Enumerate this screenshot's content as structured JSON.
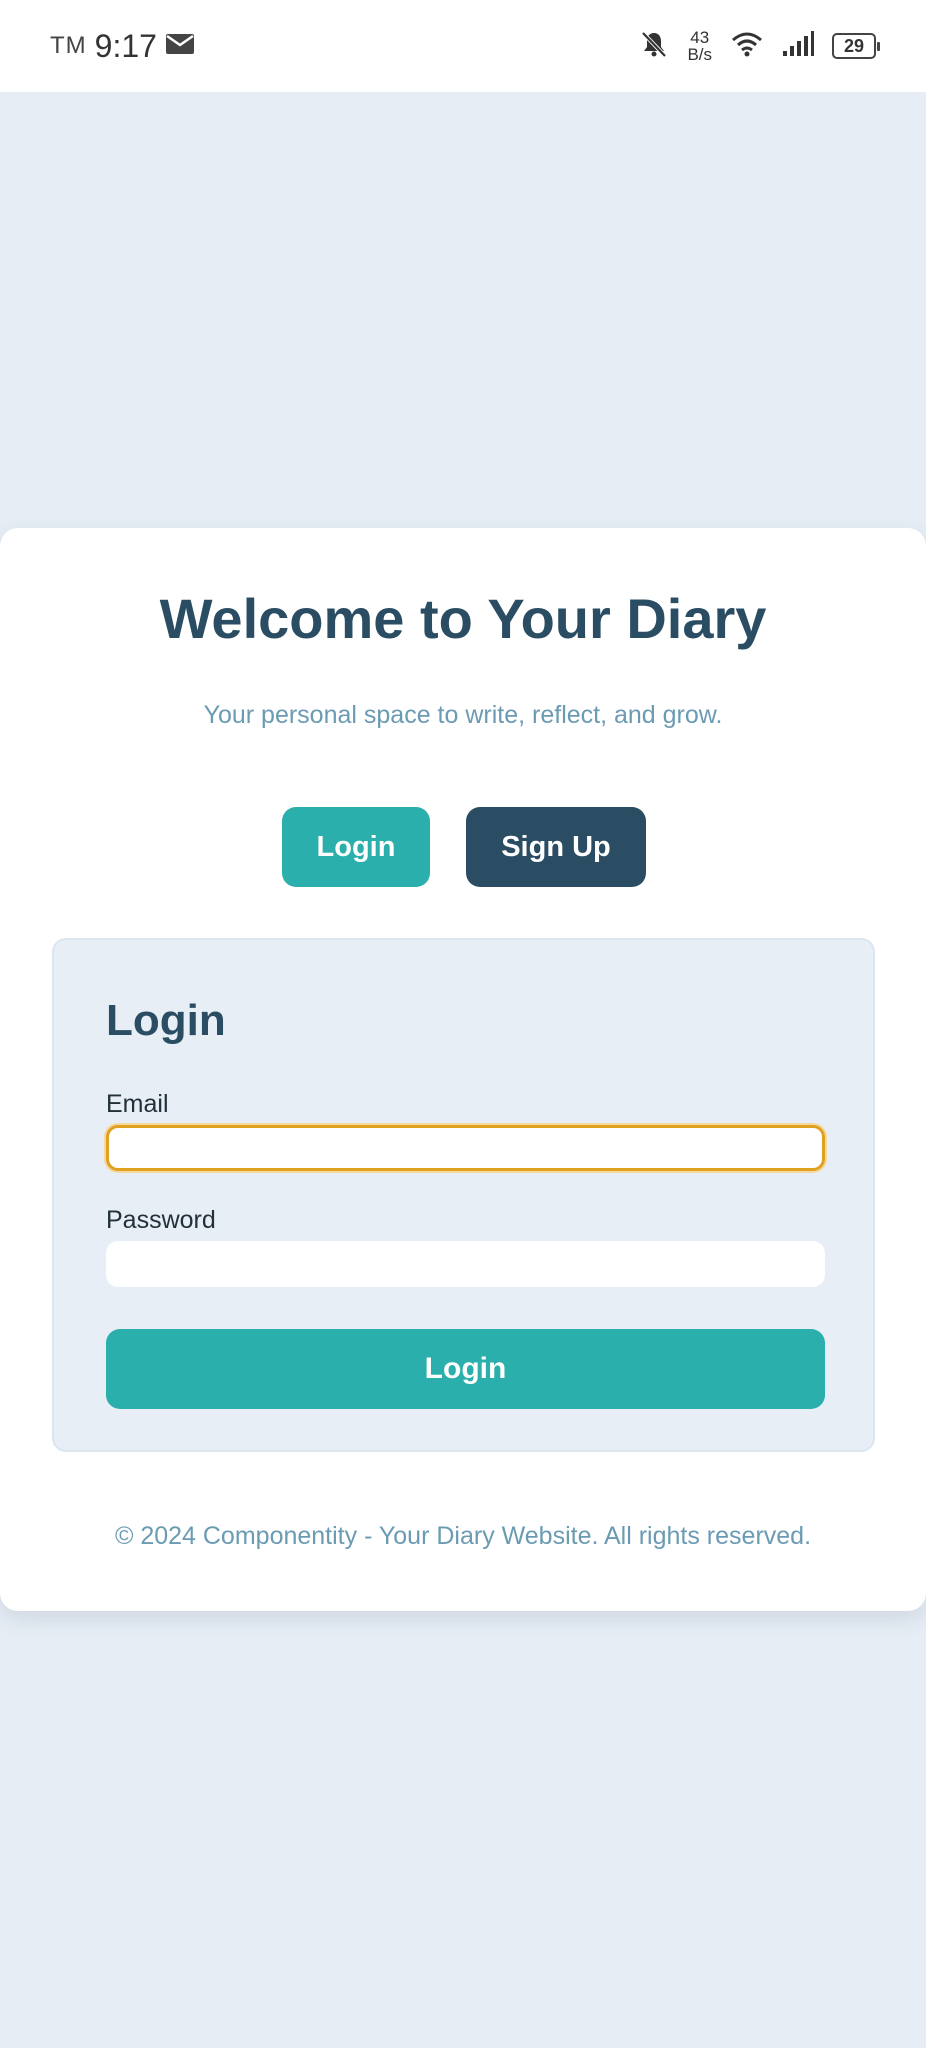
{
  "status_bar": {
    "carrier": "TM",
    "time": "9:17",
    "net_speed_value": "43",
    "net_speed_unit": "B/s",
    "battery": "29",
    "icons": [
      "mail-icon",
      "bell-muted-icon",
      "wifi-icon",
      "signal-icon",
      "battery-icon"
    ]
  },
  "hero": {
    "title": "Welcome to Your Diary",
    "subtitle": "Your personal space to write, reflect, and grow."
  },
  "top_buttons": {
    "login_label": "Login",
    "signup_label": "Sign Up"
  },
  "login_form": {
    "title": "Login",
    "email_label": "Email",
    "email_value": "",
    "password_label": "Password",
    "password_value": "",
    "submit_label": "Login"
  },
  "footer": {
    "text": "© 2024 Componentity - Your Diary Website. All rights reserved."
  },
  "colors": {
    "background": "#e6edf5",
    "primary_teal": "#2aafac",
    "dark_navy": "#2a4d63",
    "muted_text": "#6a9bb3",
    "focus_outline": "#e0a020"
  }
}
